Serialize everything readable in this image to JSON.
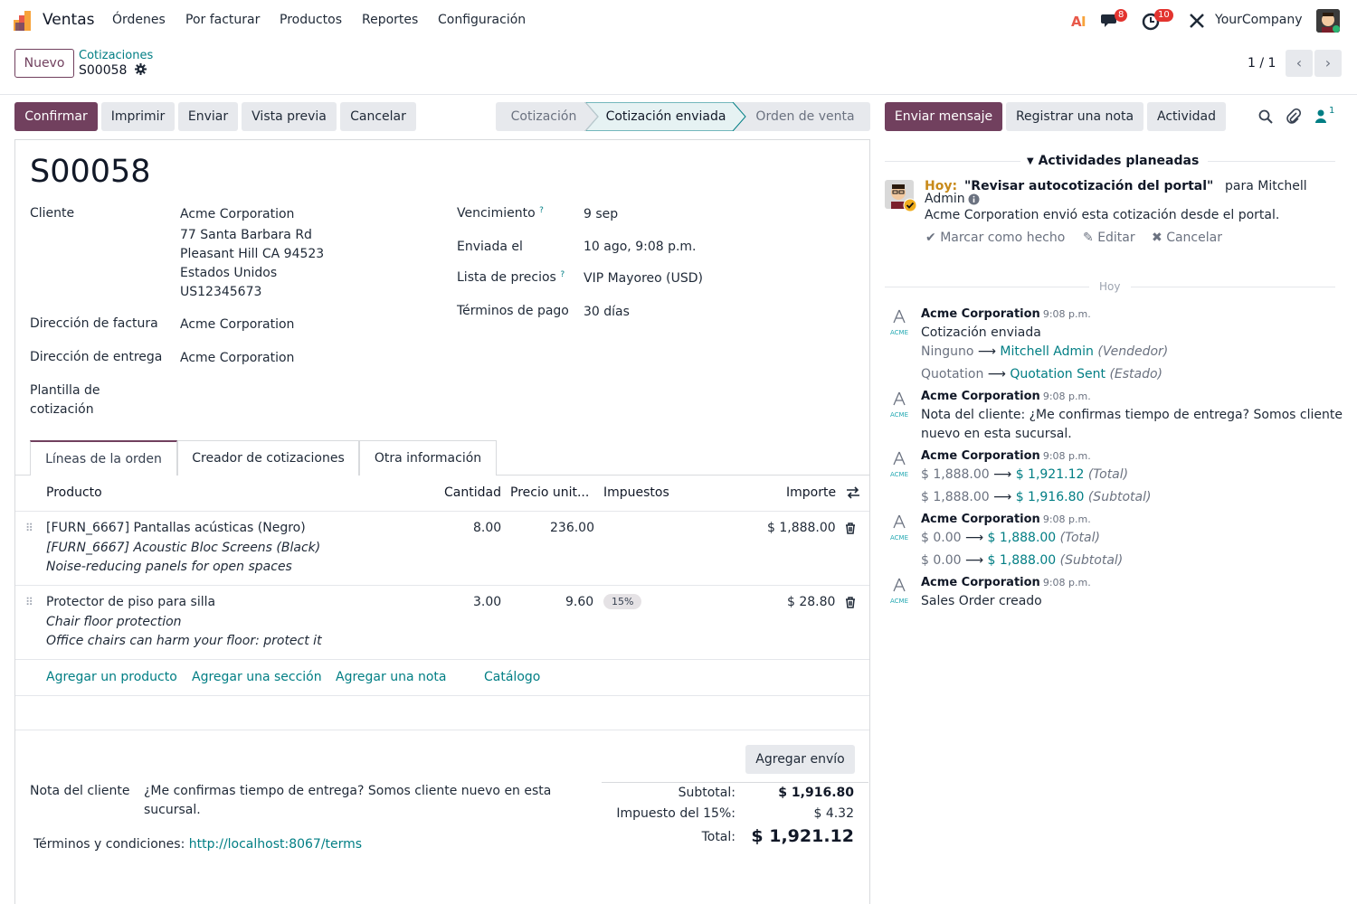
{
  "navbar": {
    "app_name": "Ventas",
    "menu": [
      "Órdenes",
      "Por facturar",
      "Productos",
      "Reportes",
      "Configuración"
    ],
    "messages_count": "8",
    "activities_count": "10",
    "company": "YourCompany"
  },
  "control": {
    "new_label": "Nuevo",
    "breadcrumb_parent": "Cotizaciones",
    "breadcrumb_current": "S00058",
    "pager": "1 / 1"
  },
  "actions": {
    "confirm": "Confirmar",
    "print": "Imprimir",
    "send": "Enviar",
    "preview": "Vista previa",
    "cancel": "Cancelar"
  },
  "statusbar": {
    "steps": [
      "Cotización",
      "Cotización enviada",
      "Orden de venta"
    ],
    "active": "Cotización enviada"
  },
  "form": {
    "name": "S00058",
    "customer_label": "Cliente",
    "customer_lines": [
      "Acme Corporation",
      "77 Santa Barbara Rd",
      "Pleasant Hill CA 94523",
      "Estados Unidos",
      "US12345673"
    ],
    "invoice_addr_label": "Dirección de factura",
    "invoice_addr": "Acme Corporation",
    "delivery_addr_label": "Dirección de entrega",
    "delivery_addr": "Acme Corporation",
    "template_label_1": "Plantilla de",
    "template_label_2": "cotización",
    "expiry_label": "Vencimiento",
    "expiry": "9 sep",
    "sent_label": "Enviada el",
    "sent": "10 ago, 9:08 p.m.",
    "pricelist_label": "Lista de precios",
    "pricelist": "VIP Mayoreo (USD)",
    "payment_terms_label": "Términos de pago",
    "payment_terms": "30 días",
    "help_mark": "?"
  },
  "tabs": [
    "Líneas de la orden",
    "Creador de cotizaciones",
    "Otra información"
  ],
  "lines": {
    "headers": {
      "product": "Producto",
      "qty": "Cantidad",
      "price": "Precio unit...",
      "taxes": "Impuestos",
      "amount": "Importe"
    },
    "rows": [
      {
        "name": "[FURN_6667] Pantallas acústicas (Negro)",
        "desc1": "[FURN_6667] Acoustic Bloc Screens (Black)",
        "desc2": "Noise-reducing panels for open spaces",
        "qty": "8.00",
        "price": "236.00",
        "tax": "",
        "amount": "$ 1,888.00"
      },
      {
        "name": "Protector de piso para silla",
        "desc1": "Chair floor protection",
        "desc2": "Office chairs can harm your floor: protect it",
        "qty": "3.00",
        "price": "9.60",
        "tax": "15%",
        "amount": "$ 28.80"
      }
    ],
    "add_product": "Agregar un producto",
    "add_section": "Agregar una sección",
    "add_note": "Agregar una nota",
    "catalog": "Catálogo"
  },
  "footer": {
    "add_shipping": "Agregar envío",
    "note_label": "Nota del cliente",
    "note_line1": "¿Me confirmas tiempo de entrega? Somos cliente nuevo en esta",
    "note_line2": "sucursal.",
    "terms_label": "Términos y condiciones:",
    "terms_link": "http://localhost:8067/terms",
    "subtotal_label": "Subtotal:",
    "subtotal": "$ 1,916.80",
    "tax_label": "Impuesto del 15%:",
    "tax": "$ 4.32",
    "total_label": "Total:",
    "total": "$ 1,921.12"
  },
  "chatter": {
    "send_message": "Enviar mensaje",
    "log_note": "Registrar una nota",
    "activity": "Actividad",
    "followers_count": "1",
    "planned_title": "Actividades planeadas",
    "activity_today": "Hoy:",
    "activity_summary": "\"Revisar autocotización del portal\"",
    "activity_for": "para Mitchell",
    "activity_user": "Admin",
    "activity_note": "Acme Corporation envió esta cotización desde el portal.",
    "mark_done": "Marcar como hecho",
    "edit": "Editar",
    "cancel": "Cancelar",
    "today_sep": "Hoy",
    "messages": [
      {
        "author": "Acme Corporation",
        "time": "9:08 p.m.",
        "title": "Cotización enviada",
        "changes": [
          {
            "old": "Ninguno",
            "new": "Mitchell Admin",
            "field": "(Vendedor)"
          },
          {
            "old": "Quotation",
            "new": "Quotation Sent",
            "field": "(Estado)"
          }
        ]
      },
      {
        "author": "Acme Corporation",
        "time": "9:08 p.m.",
        "line1": "Nota del cliente: ¿Me confirmas tiempo de entrega? Somos cliente",
        "line2": "nuevo en esta sucursal."
      },
      {
        "author": "Acme Corporation",
        "time": "9:08 p.m.",
        "changes": [
          {
            "old": "$ 1,888.00",
            "new": "$ 1,921.12",
            "field": "(Total)"
          },
          {
            "old": "$ 1,888.00",
            "new": "$ 1,916.80",
            "field": "(Subtotal)"
          }
        ]
      },
      {
        "author": "Acme Corporation",
        "time": "9:08 p.m.",
        "changes": [
          {
            "old": "$ 0.00",
            "new": "$ 1,888.00",
            "field": "(Total)"
          },
          {
            "old": "$ 0.00",
            "new": "$ 1,888.00",
            "field": "(Subtotal)"
          }
        ]
      },
      {
        "author": "Acme Corporation",
        "time": "9:08 p.m.",
        "title": "Sales Order creado"
      }
    ],
    "arrow": "⟶",
    "acme_text": "ACME"
  },
  "colors": {
    "brand": "#71405e",
    "link": "#017e84",
    "badge": "#e3342f"
  }
}
